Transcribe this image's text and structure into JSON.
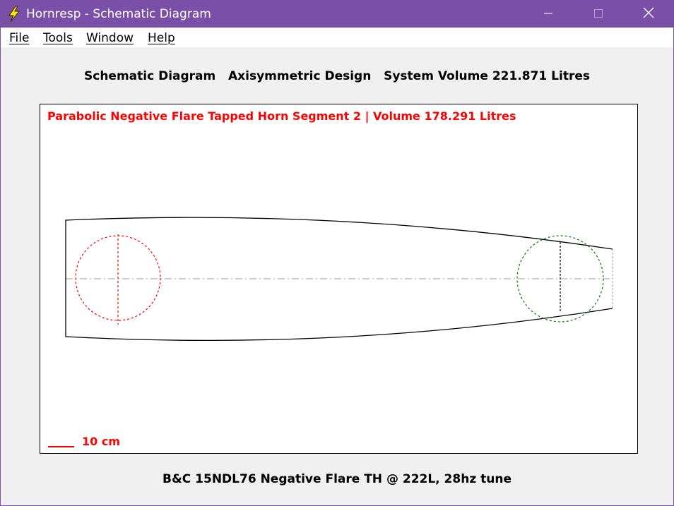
{
  "window": {
    "title": "Hornresp - Schematic Diagram",
    "icon": "lightning-bolt-icon",
    "accent_color": "#7a4fa8",
    "controls": {
      "minimize_icon": "minimize-icon",
      "maximize_icon": "maximize-icon",
      "close_icon": "close-icon"
    }
  },
  "menu": {
    "items": [
      {
        "label": "File"
      },
      {
        "label": "Tools"
      },
      {
        "label": "Window"
      },
      {
        "label": "Help"
      }
    ]
  },
  "header": {
    "diagram_label": "Schematic Diagram",
    "design_type": "Axisymmetric Design",
    "system_volume": "System Volume 221.871 Litres"
  },
  "diagram": {
    "segment_title": "Parabolic Negative Flare Tapped Horn Segment 2 | Volume 178.291 Litres",
    "scale_label": "10 cm",
    "colors": {
      "outline": "#000000",
      "driver_left": "#ff0000",
      "driver_right": "#008000",
      "axis": "#a0a0a0",
      "scale": "#ff0000"
    }
  },
  "footer": {
    "description": "B&C 15NDL76 Negative Flare TH @ 222L, 28hz tune"
  }
}
